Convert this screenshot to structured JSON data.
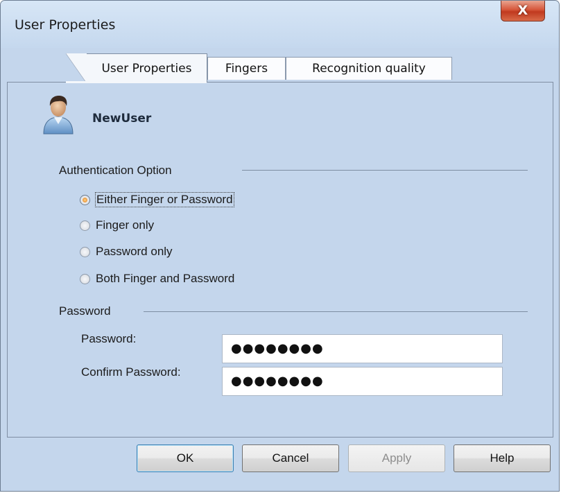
{
  "window": {
    "title": "User Properties",
    "close_glyph": "X"
  },
  "tabs": [
    {
      "label": "User Properties",
      "active": true
    },
    {
      "label": "Fingers",
      "active": false
    },
    {
      "label": "Recognition quality",
      "active": false
    }
  ],
  "user": {
    "name": "NewUser",
    "icon": "user-avatar-icon"
  },
  "auth": {
    "group_label": "Authentication Option",
    "options": [
      {
        "label": "Either Finger or Password",
        "checked": true
      },
      {
        "label": "Finger only",
        "checked": false
      },
      {
        "label": "Password only",
        "checked": false
      },
      {
        "label": "Both Finger and Password",
        "checked": false
      }
    ]
  },
  "password": {
    "group_label": "Password",
    "password_label": "Password:",
    "password_value": "●●●●●●●●",
    "confirm_label": "Confirm Password:",
    "confirm_value": "●●●●●●●●"
  },
  "buttons": {
    "ok": "OK",
    "cancel": "Cancel",
    "apply": "Apply",
    "help": "Help"
  },
  "colors": {
    "window_bg": "#c4d6ec",
    "close_button": "#c0391f",
    "radio_checked": "#e07b14"
  }
}
